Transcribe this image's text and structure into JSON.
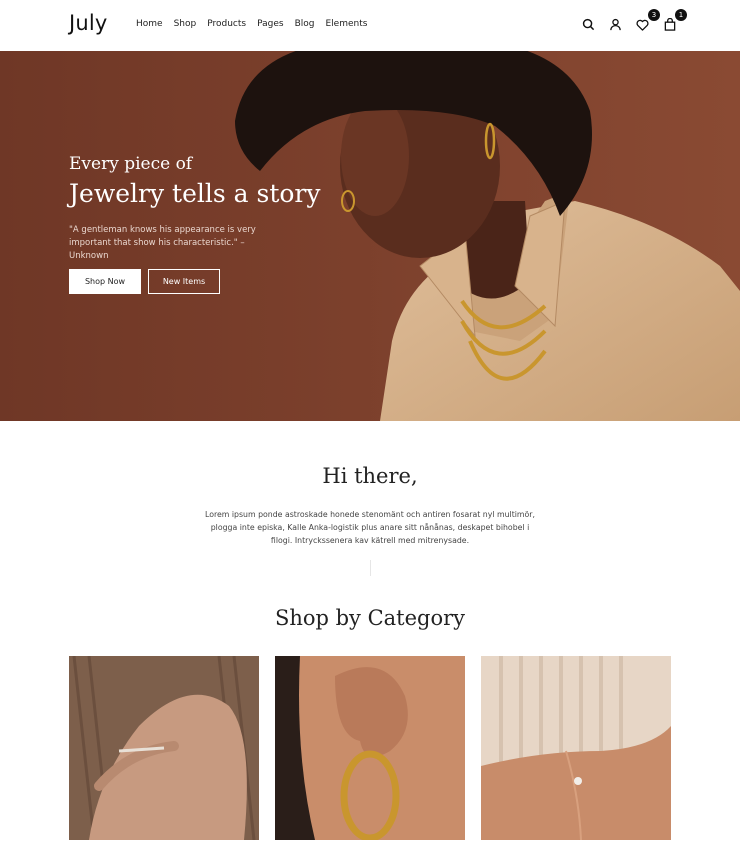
{
  "header": {
    "logo": "July",
    "nav": [
      "Home",
      "Shop",
      "Products",
      "Pages",
      "Blog",
      "Elements"
    ],
    "wishlist_count": "3",
    "cart_count": "1"
  },
  "hero": {
    "line1": "Every piece of",
    "line2": "Jewelry tells a story",
    "quote": "\"A gentleman knows his appearance is very important that show his characteristic.\" – Unknown",
    "btn_shop": "Shop Now",
    "btn_new": "New Items"
  },
  "intro": {
    "title": "Hi there,",
    "text": "Lorem ipsum ponde astroskade honede stenomänt och antiren fosarat nyl multimör, plogga inte episka, Kalle Anka-logistik plus anare sitt nånånas, deskapet bihobel i filogi. Intryckssenera kav kätrell med mitrenysade."
  },
  "categories": {
    "title": "Shop by Category"
  },
  "colors": {
    "hero_bg": "#7b3f2d",
    "shirt": "#d9b48e"
  }
}
